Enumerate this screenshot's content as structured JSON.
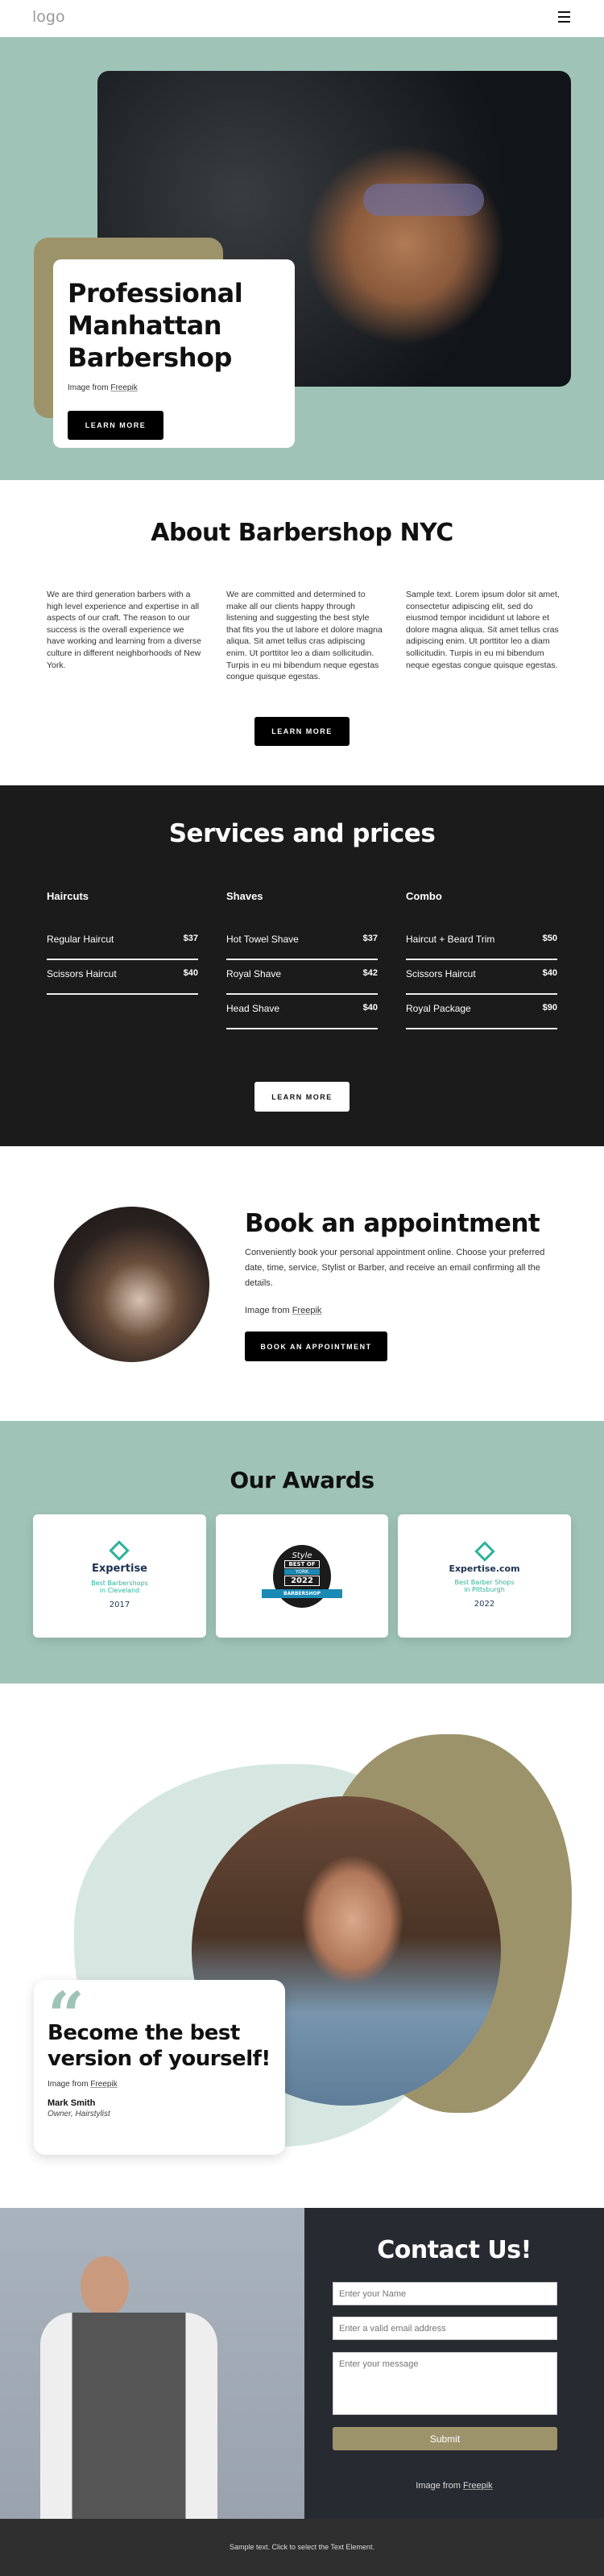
{
  "header": {
    "logo": "logo",
    "menu_icon": "hamburger-icon"
  },
  "hero": {
    "title_lines": [
      "Professional",
      "Manhattan",
      "Barbershop"
    ],
    "credit_prefix": "Image from",
    "credit_link": "Freepik",
    "button": "LEARN MORE"
  },
  "about": {
    "title": "About Barbershop NYC",
    "columns": [
      "We are third generation barbers with a high level experience and expertise in all aspects of our craft. The reason to our success is the overall experience we have working and learning from a diverse culture in different neighborhoods of New York.",
      "We are committed and determined to make all our clients happy through listening and suggesting the best style that fits you the ut labore et dolore magna aliqua. Sit amet tellus cras adipiscing enim. Ut porttitor leo a diam sollicitudin. Turpis in eu mi bibendum neque egestas congue quisque egestas.",
      "Sample text. Lorem ipsum dolor sit amet, consectetur adipiscing elit, sed do eiusmod tempor incididunt ut labore et dolore magna aliqua. Sit amet tellus cras adipiscing enim. Ut porttitor leo a diam sollicitudin. Turpis in eu mi bibendum neque egestas congue quisque egestas."
    ],
    "button": "LEARN MORE"
  },
  "services": {
    "title": "Services and prices",
    "categories": [
      {
        "name": "Haircuts",
        "items": [
          {
            "name": "Regular Haircut",
            "price": "$37"
          },
          {
            "name": "Scissors Haircut",
            "price": "$40"
          }
        ]
      },
      {
        "name": "Shaves",
        "items": [
          {
            "name": "Hot Towel Shave",
            "price": "$37"
          },
          {
            "name": "Royal Shave",
            "price": "$42"
          },
          {
            "name": "Head Shave",
            "price": "$40"
          }
        ]
      },
      {
        "name": "Combo",
        "items": [
          {
            "name": "Haircut + Beard Trim",
            "price": "$50"
          },
          {
            "name": "Scissors Haircut",
            "price": "$40"
          },
          {
            "name": "Royal Package",
            "price": "$90"
          }
        ]
      }
    ],
    "button": "LEARN MORE"
  },
  "booking": {
    "title": "Book an appointment",
    "text": "Conveniently book your personal appointment online. Choose your preferred date, time, service, Stylist or Barber, and receive an email confirming all the details.",
    "credit_prefix": "Image from",
    "credit_link": "Freepik",
    "button": "BOOK AN APPOINTMENT"
  },
  "awards": {
    "title": "Our Awards",
    "items": [
      {
        "brand": "Expertise",
        "line1": "Best Barbershops",
        "line2": "in Cleveland",
        "year": "2017"
      },
      {
        "brand": "Style",
        "line1": "BEST OF",
        "line2": "YORK",
        "year": "2022",
        "ribbon": "BARBERSHOP"
      },
      {
        "brand": "Expertise.com",
        "line1": "Best Barber Shops",
        "line2": "in Pittsburgh",
        "year": "2022"
      }
    ]
  },
  "testimonial": {
    "quote": "Become the best version of yourself!",
    "credit_prefix": "Image from",
    "credit_link": "Freepik",
    "name": "Mark Smith",
    "role": "Owner, Hairstylist"
  },
  "contact": {
    "title": "Contact Us!",
    "name_placeholder": "Enter your Name",
    "email_placeholder": "Enter a valid email address",
    "message_placeholder": "Enter your message",
    "submit": "Submit",
    "credit_prefix": "Image from",
    "credit_link": "Freepik"
  },
  "footer": {
    "text": "Sample text. Click to select the Text Element."
  },
  "colors": {
    "mint": "#9fc4b7",
    "olive": "#9d936b",
    "dark": "#1b1b1b",
    "contact_bg": "#272a31",
    "footer_bg": "#2f2f2f"
  }
}
